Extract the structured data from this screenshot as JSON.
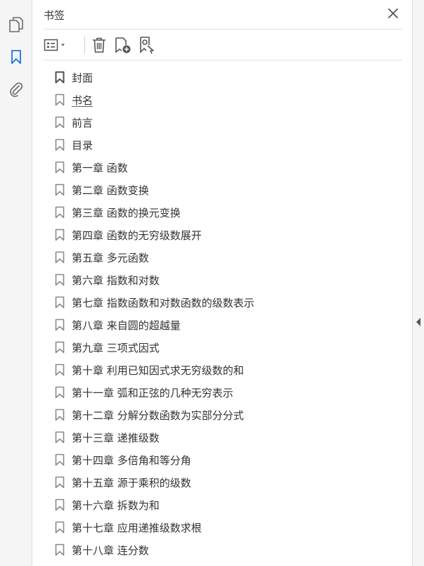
{
  "panel": {
    "title": "书签"
  },
  "rail": {
    "icons": [
      "pages-icon",
      "bookmark-icon",
      "attachment-icon"
    ],
    "active": "bookmark-icon",
    "accent": "#1473e6"
  },
  "toolbar": {
    "icons": [
      "options-menu-icon",
      "delete-icon",
      "new-bookmark-icon",
      "find-bookmark-icon"
    ]
  },
  "bookmarks": [
    {
      "label": "封面",
      "selected": true
    },
    {
      "label": "书名",
      "underlined": true
    },
    {
      "label": "前言"
    },
    {
      "label": "目录"
    },
    {
      "label": "第一章  函数"
    },
    {
      "label": "第二章  函数变换"
    },
    {
      "label": "第三章  函数的换元变换"
    },
    {
      "label": "第四章  函数的无穷级数展开"
    },
    {
      "label": "第五章  多元函数"
    },
    {
      "label": "第六章  指数和对数"
    },
    {
      "label": "第七章  指数函数和对数函数的级数表示"
    },
    {
      "label": "第八章  来自圆的超越量"
    },
    {
      "label": "第九章  三项式因式"
    },
    {
      "label": "第十章  利用已知因式求无穷级数的和"
    },
    {
      "label": "第十一章  弧和正弦的几种无穷表示"
    },
    {
      "label": "第十二章  分解分数函数为实部分分式"
    },
    {
      "label": "第十三章  递推级数"
    },
    {
      "label": "第十四章  多倍角和等分角"
    },
    {
      "label": "第十五章  源于乘积的级数"
    },
    {
      "label": "第十六章  拆数为和"
    },
    {
      "label": "第十七章  应用递推级数求根"
    },
    {
      "label": "第十八章  连分数"
    }
  ]
}
